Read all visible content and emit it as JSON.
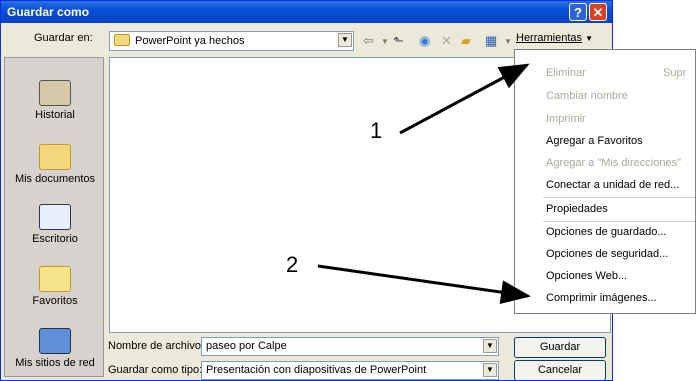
{
  "window": {
    "title": "Guardar como"
  },
  "toolbar": {
    "save_in_label": "Guardar en:",
    "save_in_value": "PowerPoint ya hechos",
    "tools_label": "Herramientas"
  },
  "places": [
    {
      "label": "Historial"
    },
    {
      "label": "Mis documentos"
    },
    {
      "label": "Escritorio"
    },
    {
      "label": "Favoritos"
    },
    {
      "label": "Mis sitios de red"
    }
  ],
  "footer": {
    "filename_label": "Nombre de archivo:",
    "filename_value": "paseo por Calpe",
    "filetype_label": "Guardar como tipo:",
    "filetype_value": "Presentación con diapositivas de PowerPoint",
    "save_button": "Guardar",
    "cancel_button": "Cancelar"
  },
  "tools_menu": {
    "items": [
      {
        "label": "Eliminar",
        "shortcut": "Supr",
        "enabled": false
      },
      {
        "label": "Cambiar nombre",
        "enabled": false
      },
      {
        "label": "Imprimir",
        "enabled": false
      },
      {
        "label": "Agregar a Favoritos",
        "enabled": true
      },
      {
        "label": "Agregar a \"Mis direcciones\"",
        "enabled": false
      },
      {
        "label": "Conectar a unidad de red...",
        "enabled": true
      },
      {
        "label": "Propiedades",
        "enabled": true
      },
      {
        "label": "Opciones de guardado...",
        "enabled": true
      },
      {
        "label": "Opciones de seguridad...",
        "enabled": true
      },
      {
        "label": "Opciones Web...",
        "enabled": true
      },
      {
        "label": "Comprimir imágenes...",
        "enabled": true
      }
    ]
  },
  "annotations": {
    "callout_1": "1",
    "callout_2": "2"
  }
}
